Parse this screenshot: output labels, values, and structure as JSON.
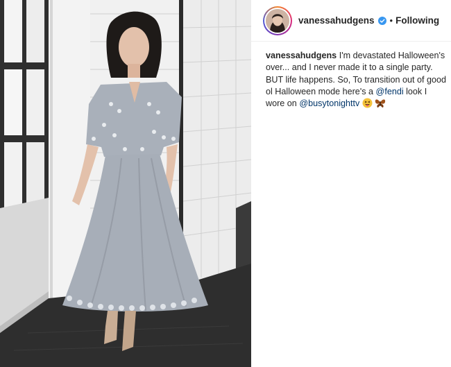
{
  "post": {
    "username": "vanessahudgens",
    "verified": true,
    "separator": "•",
    "follow_status": "Following",
    "caption": {
      "username": "vanessahudgens",
      "text_part1": "I'm devastated Halloween's over... and I never made it to a single party. BUT life happens. So, To transition out of good ol Halloween mode here's a ",
      "mention1": "@fendi",
      "text_part2": " look I wore on ",
      "mention2": "@busytonighttv",
      "emojis": [
        "grinning-tongue-emoji",
        "butterfly-emoji"
      ]
    }
  },
  "colors": {
    "text": "#262626",
    "mention": "#003569",
    "verified_badge": "#3897f0",
    "divider": "#efefef"
  }
}
